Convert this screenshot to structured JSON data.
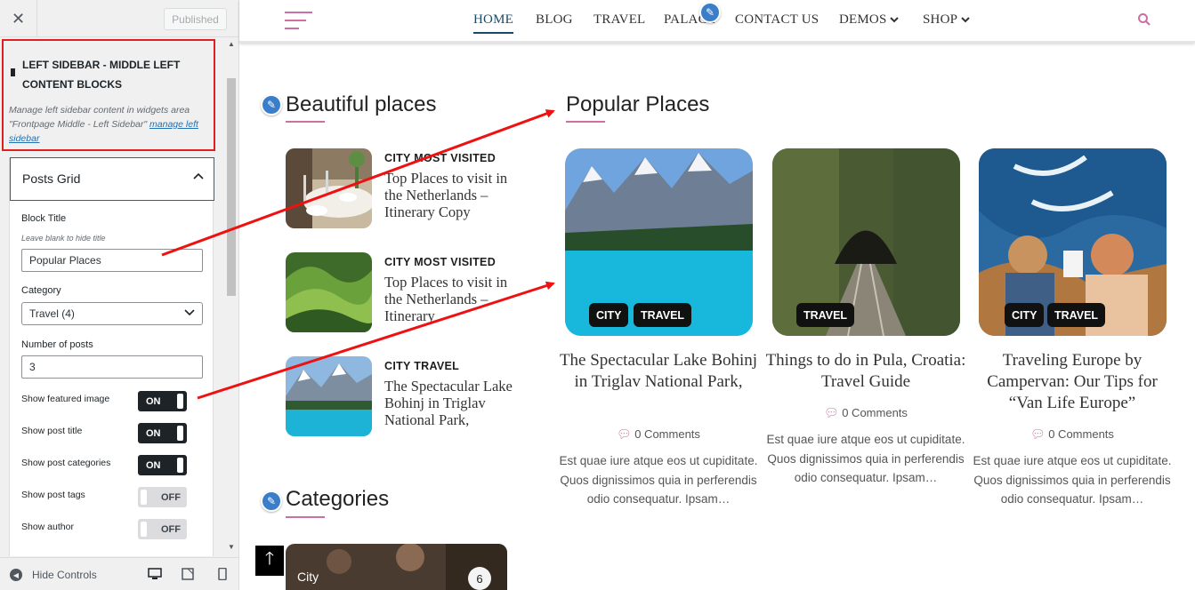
{
  "customizer": {
    "close_icon": "close-icon",
    "published_label": "Published",
    "section": {
      "title": "LEFT SIDEBAR - MIDDLE LEFT CONTENT BLOCKS",
      "description": "Manage left sidebar content in widgets area \"Frontpage Middle - Left Sidebar\" ",
      "link_text": "manage left sidebar"
    },
    "widget": {
      "title": "Posts Grid",
      "block_title_label": "Block Title",
      "block_title_hint": "Leave blank to hide title",
      "block_title_value": "Popular Places",
      "category_label": "Category",
      "category_value": "Travel (4)",
      "posts_label": "Number of posts",
      "posts_value": "3",
      "toggles": [
        {
          "label": "Show featured image",
          "state": "ON"
        },
        {
          "label": "Show post title",
          "state": "ON"
        },
        {
          "label": "Show post categories",
          "state": "ON"
        },
        {
          "label": "Show post tags",
          "state": "OFF"
        },
        {
          "label": "Show author",
          "state": "OFF"
        }
      ]
    },
    "footer": {
      "hide_controls": "Hide Controls"
    }
  },
  "site": {
    "nav": {
      "items": [
        "HOME",
        "BLOG",
        "TRAVEL",
        "PALACE",
        "CONTACT US",
        "DEMOS",
        "SHOP"
      ],
      "active": "HOME",
      "accent": "#cc6fa5"
    },
    "beautiful_places": {
      "heading": "Beautiful places",
      "posts": [
        {
          "categories": "CITY  MOST VISITED",
          "title": "Top Places to visit in the Netherlands – Itinerary Copy"
        },
        {
          "categories": "CITY  MOST VISITED",
          "title": "Top Places to visit in the Netherlands – Itinerary"
        },
        {
          "categories": "CITY  TRAVEL",
          "title": "The Spectacular Lake Bohinj in Triglav National Park,"
        }
      ]
    },
    "popular_places": {
      "heading": "Popular Places",
      "cards": [
        {
          "tags": [
            "CITY",
            "TRAVEL"
          ],
          "title": "The Spectacular Lake Bohinj in Triglav National Park,",
          "comments": "0 Comments",
          "excerpt": "Est quae iure atque eos ut cupiditate. Quos dignissimos quia in perferendis odio consequatur. Ipsam…"
        },
        {
          "tags": [
            "TRAVEL"
          ],
          "title": "Things to do in Pula, Croatia: Travel Guide",
          "comments": "0 Comments",
          "excerpt": "Est quae iure atque eos ut cupiditate. Quos dignissimos quia in perferendis odio consequatur. Ipsam…"
        },
        {
          "tags": [
            "CITY",
            "TRAVEL"
          ],
          "title": "Traveling Europe by Campervan: Our Tips for “Van Life Europe”",
          "comments": "0 Comments",
          "excerpt": "Est quae iure atque eos ut cupiditate. Quos dignissimos quia in perferendis odio consequatur. Ipsam…"
        }
      ]
    },
    "categories": {
      "heading": "Categories",
      "first": {
        "name": "City",
        "count": "6"
      }
    }
  }
}
